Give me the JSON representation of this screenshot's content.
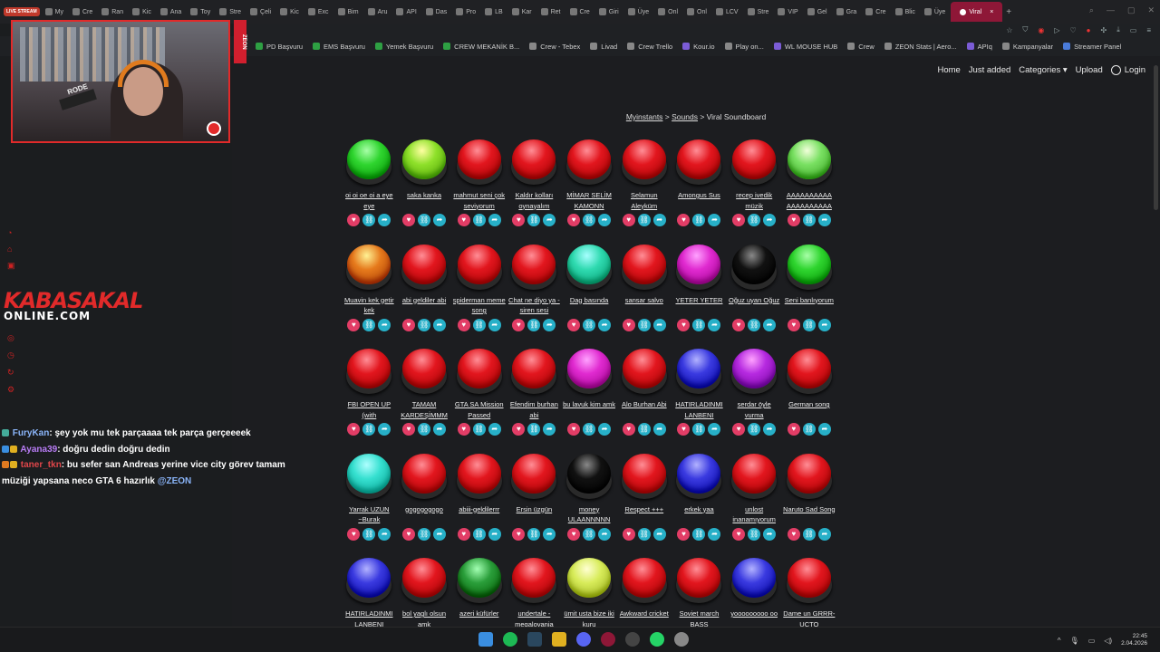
{
  "browser": {
    "live_badge": "LIVE STREAM",
    "tabs": [
      "My",
      "Cre",
      "Ran",
      "Kic",
      "Ana",
      "Toy",
      "Stre",
      "Çeli",
      "Kic",
      "Exc",
      "Bim",
      "Aru",
      "API",
      "Das",
      "Pro",
      "LB",
      "Kar",
      "Ret",
      "Cre",
      "Giri",
      "Üye",
      "Onl",
      "Onl",
      "LCV",
      "Stre",
      "VIP",
      "Gel",
      "Gra",
      "Cre",
      "Blic",
      "Üye"
    ],
    "active_tab": "Viral",
    "bookmarks": [
      "PD Başvuru",
      "EMS Başvuru",
      "Yemek Başvuru",
      "CREW MEKANİK B...",
      "Crew - Tebex",
      "Livad",
      "Crew Trello",
      "Kour.io",
      "Play on...",
      "WL MOUSE HUB",
      "Crew",
      "ZEON Stats | Aero...",
      "APIq",
      "Kampanyalar",
      "Streamer Panel"
    ]
  },
  "site": {
    "nav": [
      "Home",
      "Just added",
      "Categories ▾",
      "Upload"
    ],
    "login": "Login",
    "breadcrumb": {
      "home": "Myinstants",
      "sep1": " > ",
      "sounds": "Sounds",
      "sep2": " > ",
      "current": "Viral Soundboard"
    }
  },
  "sounds": [
    [
      {
        "label": "oi oi oe oi a eye eye",
        "color": "#2fd52f"
      },
      {
        "label": "saka kanka",
        "color": "#8ee02a"
      },
      {
        "label": "mahmut seni çok seviyorum",
        "color": "#e2161e"
      },
      {
        "label": "Kaldır kolları oynayalım",
        "color": "#e2161e"
      },
      {
        "label": "MİMAR SELİM KAMONN",
        "color": "#e2161e"
      },
      {
        "label": "Selamun Aleyküm",
        "color": "#e2161e"
      },
      {
        "label": "Amongus Sus",
        "color": "#e2161e"
      },
      {
        "label": "recep ivedik müzik",
        "color": "#e2161e"
      },
      {
        "label": "AAAAAAAAAA AAAAAAAAAA",
        "color": "#79e062"
      }
    ],
    [
      {
        "label": "Muavin kek getir kek",
        "color": "#e67a1c"
      },
      {
        "label": "abi geldiler abi",
        "color": "#e2161e"
      },
      {
        "label": "spiderman meme song",
        "color": "#e2161e"
      },
      {
        "label": "Chat ne diyo ya - siren sesi",
        "color": "#e2161e"
      },
      {
        "label": "Dag basında",
        "color": "#2fdab0"
      },
      {
        "label": "sansar salvo",
        "color": "#e2161e"
      },
      {
        "label": "YETER YETER",
        "color": "#e02ad0"
      },
      {
        "label": "Oğuz uyan Oğuz",
        "color": "#111111"
      },
      {
        "label": "Seni banlıyorum",
        "color": "#2fd52f"
      }
    ],
    [
      {
        "label": "FBI OPEN UP (with",
        "color": "#e2161e"
      },
      {
        "label": "TAMAM KARDEŞİMMM",
        "color": "#e2161e"
      },
      {
        "label": "GTA SA Mission Passed",
        "color": "#e2161e"
      },
      {
        "label": "Efendim burhan abi",
        "color": "#e2161e"
      },
      {
        "label": "bu lavuk kim amk",
        "color": "#e02ad0"
      },
      {
        "label": "Alo Burhan Abi",
        "color": "#e2161e"
      },
      {
        "label": "HATIRLADINMI LANBENI",
        "color": "#3a3ae0"
      },
      {
        "label": "serdar öyle vurma",
        "color": "#b62ae0"
      },
      {
        "label": "German song",
        "color": "#e2161e"
      }
    ],
    [
      {
        "label": "Yarrak UZUN ~Burak",
        "color": "#36e0d0"
      },
      {
        "label": "gogogogogo",
        "color": "#e2161e"
      },
      {
        "label": "abiii-geldilerrr",
        "color": "#e2161e"
      },
      {
        "label": "Ersin üzgün",
        "color": "#e2161e"
      },
      {
        "label": "money ULAANNNNN",
        "color": "#111111"
      },
      {
        "label": "Respect +++",
        "color": "#e2161e"
      },
      {
        "label": "erkek yaa",
        "color": "#3a3ae0"
      },
      {
        "label": "unlost inanamıyorum",
        "color": "#e2161e"
      },
      {
        "label": "Naruto Sad Song",
        "color": "#e2161e"
      }
    ],
    [
      {
        "label": "HATIRLADINMI LANBENI",
        "color": "#3a3ae0"
      },
      {
        "label": "bol yaglı olsun amk",
        "color": "#e2161e"
      },
      {
        "label": "azeri küfürler",
        "color": "#2a9e3a"
      },
      {
        "label": "undertale - megalovania",
        "color": "#e2161e"
      },
      {
        "label": "ümit usta bize iki kuru",
        "color": "#d8ec5a"
      },
      {
        "label": "Awkward cricket",
        "color": "#e2161e"
      },
      {
        "label": "Soviet march BASS",
        "color": "#e2161e"
      },
      {
        "label": "yooooooooo oo",
        "color": "#3a3ae0"
      },
      {
        "label": "Dame un GRRR-UCTO",
        "color": "#e2161e"
      }
    ]
  ],
  "overlay": {
    "cam_tag": "ZEON",
    "mic_label": "RODE",
    "brand_line1": "KABASAKAL",
    "brand_line2": "ONLINE.COM",
    "chat": [
      {
        "user": "FuryKan",
        "text": ": şey yok mu tek parçaaaa tek parça gerçeeeek"
      },
      {
        "user": "Ayana39",
        "text": ": doğru dedin doğru dedin"
      },
      {
        "user": "taner_tkn",
        "text": ": bu sefer san Andreas yerine vice city görev tamam müziği yapsana neco GTA 6 hazırlık ",
        "mention": "@ZEON"
      }
    ]
  },
  "taskbar": {
    "time": "22:45",
    "date": "2.04.2026"
  }
}
